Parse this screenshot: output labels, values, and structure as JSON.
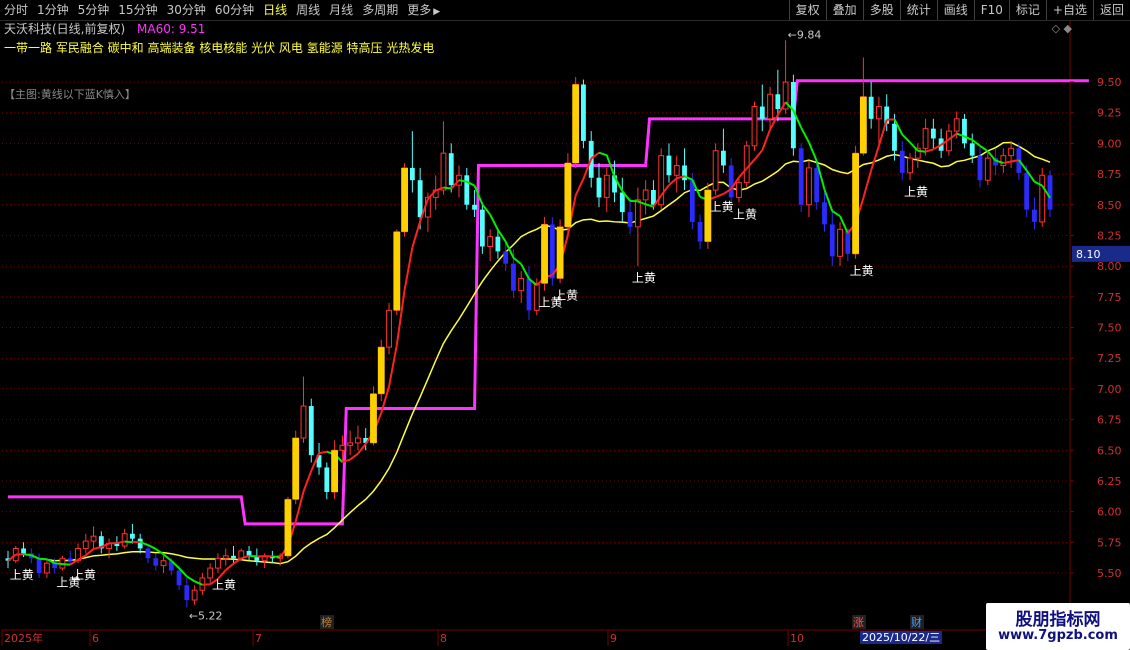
{
  "toolbar": {
    "periods": [
      "分时",
      "1分钟",
      "5分钟",
      "15分钟",
      "30分钟",
      "60分钟",
      "日线",
      "周线",
      "月线",
      "多周期",
      "更多"
    ],
    "active_period": "日线",
    "more_arrow": "▶",
    "tools": [
      "复权",
      "叠加",
      "多股",
      "统计",
      "画线",
      "F10",
      "标记",
      "+自选",
      "返回"
    ]
  },
  "header": {
    "stock_title": "天沃科技(日线,前复权)",
    "ma_label": "MA60: 9.51",
    "concepts": "一带一路 军民融合 碳中和 高端装备 核电核能 光伏 风电 氢能源 特高压 光热发电",
    "indicator_label": "【主图:黄线以下蓝K慎入】",
    "corner_icons": "◇ ◆"
  },
  "colors": {
    "background": "#000000",
    "grid": "#7a0000",
    "axis_text": "#d03030",
    "up_candle": "#ff3232",
    "down_candle": "#54ffff",
    "warn_candle": "#2b2bff",
    "ma_short_up": "#ff2020",
    "ma_short_down": "#00ee00",
    "ma_long": "#ffff40",
    "ma60": "#ff33ff",
    "signal_bar": "#ffd000",
    "signal_text": "#ffffff"
  },
  "watermark": {
    "line1": "股朋指标网",
    "line2": "www.7gpzb.com"
  },
  "chart_data": {
    "type": "candlestick",
    "title": "天沃科技(日线,前复权)",
    "y_ticks": [
      5.5,
      5.75,
      6.0,
      6.25,
      6.5,
      6.75,
      7.0,
      7.25,
      7.5,
      7.75,
      8.0,
      8.25,
      8.5,
      8.75,
      9.0,
      9.25,
      9.5
    ],
    "ylim": [
      5.25,
      9.75
    ],
    "last_price": "8.10",
    "x_labels": [
      "2025年",
      "6",
      "7",
      "8",
      "9",
      "10"
    ],
    "date_badge": "2025/10/22/三",
    "event_markers": [
      "榜",
      "涨",
      "财"
    ],
    "annotations": {
      "high": "9.84",
      "low": "5.22"
    },
    "signal_label": "上黄",
    "grid": true,
    "candles": [
      [
        5.62,
        5.68,
        5.54,
        5.6
      ],
      [
        5.6,
        5.72,
        5.58,
        5.7
      ],
      [
        5.7,
        5.75,
        5.63,
        5.66
      ],
      [
        5.66,
        5.7,
        5.58,
        5.62
      ],
      [
        5.62,
        5.66,
        5.46,
        5.5
      ],
      [
        5.5,
        5.6,
        5.46,
        5.58
      ],
      [
        5.58,
        5.62,
        5.5,
        5.54
      ],
      [
        5.54,
        5.64,
        5.52,
        5.62
      ],
      [
        5.62,
        5.68,
        5.56,
        5.6
      ],
      [
        5.6,
        5.74,
        5.58,
        5.7
      ],
      [
        5.7,
        5.82,
        5.66,
        5.76
      ],
      [
        5.76,
        5.88,
        5.7,
        5.8
      ],
      [
        5.8,
        5.84,
        5.66,
        5.7
      ],
      [
        5.7,
        5.78,
        5.62,
        5.74
      ],
      [
        5.74,
        5.8,
        5.68,
        5.72
      ],
      [
        5.72,
        5.86,
        5.7,
        5.82
      ],
      [
        5.82,
        5.9,
        5.74,
        5.78
      ],
      [
        5.78,
        5.82,
        5.66,
        5.7
      ],
      [
        5.7,
        5.74,
        5.58,
        5.62
      ],
      [
        5.62,
        5.66,
        5.52,
        5.56
      ],
      [
        5.56,
        5.64,
        5.5,
        5.6
      ],
      [
        5.6,
        5.62,
        5.48,
        5.52
      ],
      [
        5.52,
        5.56,
        5.36,
        5.4
      ],
      [
        5.4,
        5.46,
        5.22,
        5.28
      ],
      [
        5.28,
        5.4,
        5.24,
        5.36
      ],
      [
        5.36,
        5.5,
        5.32,
        5.46
      ],
      [
        5.46,
        5.58,
        5.42,
        5.54
      ],
      [
        5.54,
        5.66,
        5.5,
        5.62
      ],
      [
        5.62,
        5.7,
        5.56,
        5.64
      ],
      [
        5.64,
        5.72,
        5.58,
        5.62
      ],
      [
        5.62,
        5.7,
        5.6,
        5.68
      ],
      [
        5.68,
        5.72,
        5.6,
        5.64
      ],
      [
        5.64,
        5.7,
        5.56,
        5.6
      ],
      [
        5.6,
        5.66,
        5.54,
        5.64
      ],
      [
        5.64,
        5.68,
        5.58,
        5.62
      ],
      [
        5.62,
        5.66,
        5.56,
        5.64
      ],
      [
        5.64,
        6.12,
        5.62,
        6.1
      ],
      [
        6.1,
        6.66,
        6.06,
        6.6
      ],
      [
        6.6,
        7.1,
        6.56,
        6.86
      ],
      [
        6.86,
        6.92,
        6.4,
        6.46
      ],
      [
        6.46,
        6.56,
        6.3,
        6.36
      ],
      [
        6.36,
        6.4,
        6.1,
        6.16
      ],
      [
        6.16,
        6.58,
        6.1,
        6.5
      ],
      [
        6.5,
        6.62,
        6.4,
        6.54
      ],
      [
        6.54,
        6.66,
        6.46,
        6.56
      ],
      [
        6.56,
        6.7,
        6.5,
        6.6
      ],
      [
        6.6,
        6.68,
        6.5,
        6.56
      ],
      [
        6.56,
        7.02,
        6.54,
        6.96
      ],
      [
        6.96,
        7.4,
        6.9,
        7.34
      ],
      [
        7.34,
        7.7,
        7.28,
        7.64
      ],
      [
        7.64,
        8.3,
        7.6,
        8.28
      ],
      [
        8.28,
        8.84,
        8.24,
        8.8
      ],
      [
        8.8,
        9.1,
        8.6,
        8.7
      ],
      [
        8.7,
        8.8,
        8.3,
        8.4
      ],
      [
        8.4,
        8.6,
        8.28,
        8.56
      ],
      [
        8.56,
        8.74,
        8.46,
        8.62
      ],
      [
        8.62,
        9.18,
        8.58,
        8.92
      ],
      [
        8.92,
        9.0,
        8.6,
        8.66
      ],
      [
        8.66,
        8.82,
        8.56,
        8.74
      ],
      [
        8.74,
        8.8,
        8.46,
        8.5
      ],
      [
        8.5,
        8.62,
        8.4,
        8.46
      ],
      [
        8.46,
        8.52,
        8.1,
        8.16
      ],
      [
        8.16,
        8.3,
        8.04,
        8.24
      ],
      [
        8.24,
        8.3,
        8.06,
        8.12
      ],
      [
        8.12,
        8.2,
        7.96,
        8.02
      ],
      [
        8.02,
        8.14,
        7.74,
        7.8
      ],
      [
        7.8,
        7.96,
        7.7,
        7.9
      ],
      [
        7.9,
        8.0,
        7.56,
        7.64
      ],
      [
        7.64,
        7.9,
        7.6,
        7.86
      ],
      [
        7.86,
        8.4,
        7.8,
        8.34
      ],
      [
        8.34,
        8.4,
        7.84,
        7.9
      ],
      [
        7.9,
        8.38,
        7.86,
        8.32
      ],
      [
        8.32,
        8.92,
        8.28,
        8.84
      ],
      [
        8.84,
        9.54,
        8.8,
        9.48
      ],
      [
        9.48,
        9.52,
        8.96,
        9.02
      ],
      [
        9.02,
        9.1,
        8.64,
        8.72
      ],
      [
        8.72,
        8.84,
        8.48,
        8.56
      ],
      [
        8.56,
        8.8,
        8.44,
        8.74
      ],
      [
        8.74,
        8.86,
        8.52,
        8.6
      ],
      [
        8.6,
        8.72,
        8.36,
        8.44
      ],
      [
        8.44,
        8.56,
        8.26,
        8.32
      ],
      [
        8.32,
        8.64,
        8.0,
        8.54
      ],
      [
        8.54,
        8.7,
        8.42,
        8.62
      ],
      [
        8.62,
        8.7,
        8.46,
        8.5
      ],
      [
        8.5,
        8.96,
        8.46,
        8.9
      ],
      [
        8.9,
        9.0,
        8.68,
        8.74
      ],
      [
        8.74,
        8.9,
        8.6,
        8.82
      ],
      [
        8.82,
        8.96,
        8.62,
        8.7
      ],
      [
        8.7,
        8.76,
        8.3,
        8.36
      ],
      [
        8.36,
        8.42,
        8.14,
        8.2
      ],
      [
        8.2,
        8.68,
        8.14,
        8.62
      ],
      [
        8.62,
        9.0,
        8.58,
        8.94
      ],
      [
        8.94,
        9.12,
        8.76,
        8.82
      ],
      [
        8.82,
        8.88,
        8.5,
        8.56
      ],
      [
        8.56,
        8.72,
        8.52,
        8.68
      ],
      [
        8.68,
        9.02,
        8.64,
        8.98
      ],
      [
        8.98,
        9.34,
        8.94,
        9.3
      ],
      [
        9.3,
        9.48,
        9.1,
        9.2
      ],
      [
        9.2,
        9.46,
        9.12,
        9.4
      ],
      [
        9.4,
        9.6,
        9.18,
        9.28
      ],
      [
        9.28,
        9.84,
        9.24,
        9.5
      ],
      [
        9.5,
        9.56,
        8.9,
        8.96
      ],
      [
        8.96,
        9.0,
        8.44,
        8.5
      ],
      [
        8.5,
        8.86,
        8.4,
        8.8
      ],
      [
        8.8,
        8.86,
        8.46,
        8.52
      ],
      [
        8.52,
        8.6,
        8.28,
        8.34
      ],
      [
        8.34,
        8.44,
        8.0,
        8.08
      ],
      [
        8.08,
        8.36,
        8.0,
        8.3
      ],
      [
        8.3,
        8.26,
        8.04,
        8.1
      ],
      [
        8.1,
        8.98,
        8.06,
        8.92
      ],
      [
        8.92,
        9.7,
        8.9,
        9.38
      ],
      [
        9.38,
        9.5,
        9.12,
        9.2
      ],
      [
        9.2,
        9.38,
        9.0,
        9.3
      ],
      [
        9.3,
        9.4,
        9.1,
        9.16
      ],
      [
        9.16,
        9.24,
        8.86,
        8.94
      ],
      [
        8.94,
        9.02,
        8.7,
        8.76
      ],
      [
        8.76,
        8.92,
        8.7,
        8.88
      ],
      [
        8.88,
        9.0,
        8.8,
        8.96
      ],
      [
        8.96,
        9.2,
        8.9,
        9.12
      ],
      [
        9.12,
        9.2,
        8.96,
        9.04
      ],
      [
        9.04,
        9.12,
        8.88,
        8.94
      ],
      [
        8.94,
        9.16,
        8.9,
        9.1
      ],
      [
        9.1,
        9.26,
        9.04,
        9.2
      ],
      [
        9.2,
        9.24,
        8.96,
        9.0
      ],
      [
        9.0,
        9.08,
        8.84,
        8.9
      ],
      [
        8.9,
        8.98,
        8.64,
        8.7
      ],
      [
        8.7,
        8.92,
        8.66,
        8.88
      ],
      [
        8.88,
        8.96,
        8.74,
        8.82
      ],
      [
        8.82,
        8.96,
        8.76,
        8.9
      ],
      [
        8.9,
        9.02,
        8.8,
        8.96
      ],
      [
        8.96,
        9.0,
        8.7,
        8.76
      ],
      [
        8.76,
        8.82,
        8.4,
        8.46
      ],
      [
        8.46,
        8.56,
        8.3,
        8.36
      ],
      [
        8.36,
        8.8,
        8.32,
        8.74
      ],
      [
        8.74,
        8.78,
        8.4,
        8.46
      ]
    ],
    "ma60_levels": [
      {
        "from": 0,
        "to": 30,
        "value": 6.12
      },
      {
        "from": 31,
        "to": 43,
        "value": 5.9
      },
      {
        "from": 44,
        "to": 60,
        "value": 6.84
      },
      {
        "from": 61,
        "to": 82,
        "value": 8.82
      },
      {
        "from": 83,
        "to": 101,
        "value": 9.2
      },
      {
        "from": 102,
        "to": 139,
        "value": 9.51
      }
    ]
  }
}
